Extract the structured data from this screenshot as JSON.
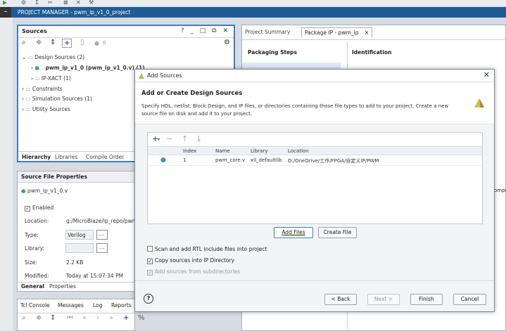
{
  "app": {
    "pm_title": "PROJECT MANAGER - pwm_ip_v1_0_project"
  },
  "sources": {
    "title": "Sources",
    "controls": "? _ □ ⧉ ✕",
    "badge": "0",
    "tree": [
      "Design Sources (2)",
      "pwm_ip_v1_0 (pwm_ip_v1_0.v) (1)",
      "IP-XACT (1)",
      "Constraints",
      "Simulation Sources (1)",
      "Utility Sources"
    ],
    "tabs": [
      "Hierarchy",
      "Libraries",
      "Compile Order"
    ]
  },
  "sfp": {
    "title": "Source File Properties",
    "file": "pwm_ip_v1_0.v",
    "enabled": "Enabled",
    "location_label": "Location:",
    "location_value": "g:/MicroBlaze/ip_repo/pwm_i",
    "type_label": "Type:",
    "type_value": "Verilog",
    "library_label": "Library:",
    "size_label": "Size:",
    "size_value": "2.2 KB",
    "modified_label": "Modified:",
    "modified_value": "Today at 15:07:34 PM",
    "tabs": [
      "General",
      "Properties"
    ]
  },
  "tcl": {
    "tabs": [
      "Tcl Console",
      "Messages",
      "Log",
      "Reports"
    ]
  },
  "right": {
    "tabs": [
      "Project Summary",
      "Package IP - pwm_ip"
    ],
    "packaging_steps": "Packaging Steps",
    "identification": "Identification",
    "clipped": "ompo"
  },
  "dialog": {
    "title": "Add Sources",
    "heading": "Add or Create Design Sources",
    "description": "Specify HDL, netlist, Block Design, and IP files, or directories containing those file types to add to your project. Create a new source file on disk and add it to your project.",
    "columns": [
      "Index",
      "Name",
      "Library",
      "Location"
    ],
    "rows": [
      {
        "index": "1",
        "name": "pwm_core.v",
        "library": "xil_defaultlib",
        "location": "D:/OneDrive/工作/FPGA/自定义IP/PWM"
      }
    ],
    "add_files": "Add Files",
    "create_file": "Create File",
    "options": [
      {
        "label": "Scan and add RTL include files into project",
        "checked": false,
        "enabled": true
      },
      {
        "label": "Copy sources into IP Directory",
        "checked": true,
        "enabled": true
      },
      {
        "label": "Add sources from subdirectories",
        "checked": true,
        "enabled": false
      }
    ],
    "back": "< Back",
    "next": "Next >",
    "finish": "Finish",
    "cancel": "Cancel",
    "help": "?"
  }
}
